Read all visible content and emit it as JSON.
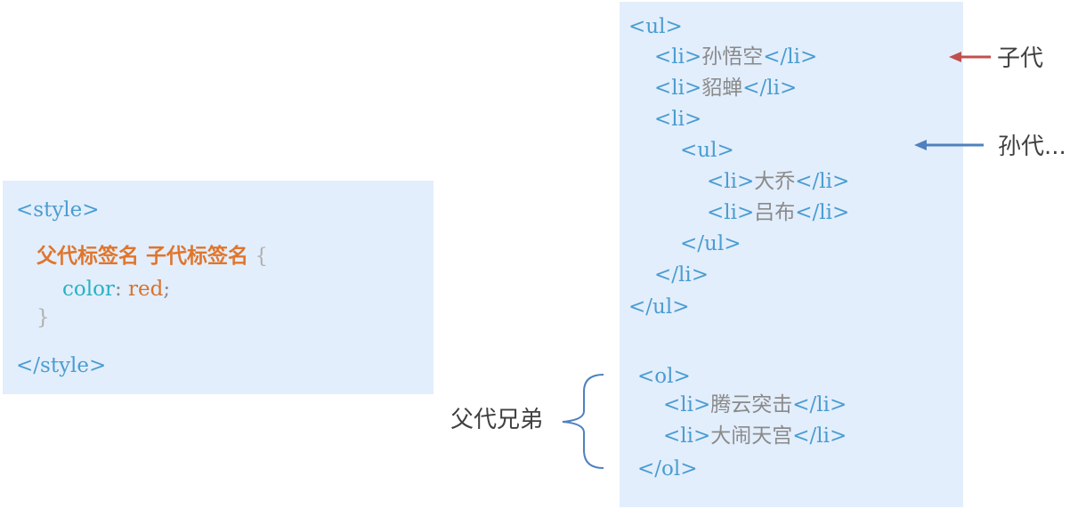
{
  "css_panel": {
    "style_open": "<style>",
    "selector": "父代标签名 子代标签名",
    "brace_open": "{",
    "property": "color",
    "colon": ":",
    "value": "red",
    "semicolon": ";",
    "brace_close": "}",
    "style_close": "</style>"
  },
  "html_panel": {
    "ul_open": "<ul>",
    "li_open": "<li>",
    "li_close": "</li>",
    "ul_close": "</ul>",
    "ol_open": "<ol>",
    "ol_close": "</ol>",
    "item_1": "孙悟空",
    "item_2": "貂蝉",
    "nested_item_1": "大乔",
    "nested_item_2": "吕布",
    "ol_item_1": "腾云突击",
    "ol_item_2": "大闹天宫"
  },
  "annotations": {
    "child_label": "子代",
    "grandchild_label": "孙代...",
    "sibling_label": "父代兄弟"
  },
  "colors": {
    "panel_bg": "#e3eefc",
    "tag": "#4a9dd1",
    "selector": "#e0752c",
    "property": "#25b3c3",
    "child_arrow": "#c0504d",
    "grandchild_arrow": "#4f81bd",
    "bracket": "#4f81bd"
  }
}
